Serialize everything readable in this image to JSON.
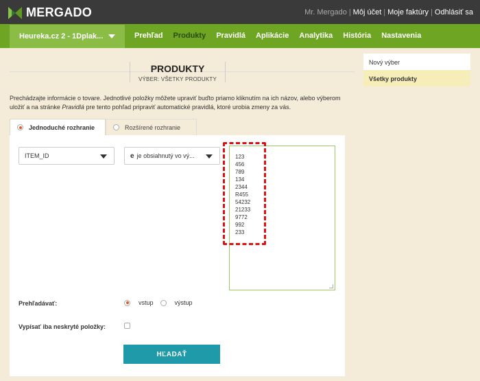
{
  "brand": {
    "name": "MERGADO"
  },
  "top_links": {
    "user": "Mr. Mergado",
    "account": "Môj účet",
    "invoices": "Moje faktúry",
    "logout": "Odhlásiť sa",
    "sep": "|"
  },
  "shop_selector": {
    "value": "Heureka.cz 2 - 1Dplak..."
  },
  "nav": {
    "items": [
      "Prehľad",
      "Produkty",
      "Pravidlá",
      "Aplikácie",
      "Analytika",
      "História",
      "Nastavenia"
    ],
    "active": "Produkty"
  },
  "header": {
    "title": "PRODUKTY",
    "subtitle": "VÝBER: VŠETKY PRODUKTY"
  },
  "description": {
    "part1": "Prechádzajte informácie o tovare. Jednotlivé položky môžete upraviť buďto priamo kliknutím na ich názov, alebo výberom uložiť a na stránke ",
    "emph": "Pravidlá",
    "part2": " pre tento pohľad pripraviť automatické pravidlá, ktoré urobia zmeny za vás."
  },
  "tabs": {
    "simple": "Jednoduché rozhranie",
    "advanced": "Rozšírené rozhranie"
  },
  "filter": {
    "field": "ITEM_ID",
    "operator_icon": "e",
    "operator": "je obsiahnutý vo vý...",
    "values": [
      "123",
      "456",
      "789",
      "134",
      "2344",
      "R455",
      "54232",
      "21233",
      "9772",
      "992",
      "233"
    ]
  },
  "search_in": {
    "label": "Prehľadávať:",
    "input": "vstup",
    "output": "výstup",
    "selected": "vstup"
  },
  "hidden_only": {
    "label": "Vypísať iba neskryté položky:",
    "checked": false
  },
  "search_button": "HĽADAŤ",
  "sidebar": {
    "new_selection": "Nový výber",
    "all_products": "Všetky produkty"
  },
  "colors": {
    "topbar": "#3a3a3a",
    "nav": "#6ea523",
    "accent_button": "#1e9aa8",
    "highlight": "#e01010"
  }
}
